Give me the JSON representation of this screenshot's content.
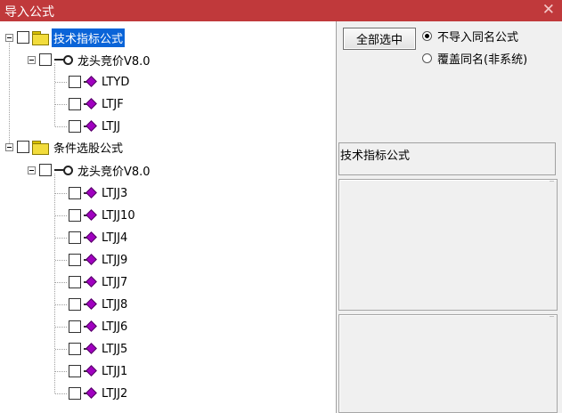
{
  "window": {
    "title": "导入公式",
    "close_glyph": "✕"
  },
  "tree": {
    "group1": {
      "label": "技术指标公式",
      "child": {
        "label": "龙头竞价V8.0",
        "items": [
          "LTYD",
          "LTJF",
          "LTJJ"
        ]
      }
    },
    "group2": {
      "label": "条件选股公式",
      "child": {
        "label": "龙头竞价V8.0",
        "items": [
          "LTJJ3",
          "LTJJ10",
          "LTJJ4",
          "LTJJ9",
          "LTJJ7",
          "LTJJ8",
          "LTJJ6",
          "LTJJ5",
          "LTJJ1",
          "LTJJ2"
        ]
      }
    }
  },
  "controls": {
    "select_all_label": "全部选中",
    "radio_no_import": "不导入同名公式",
    "radio_overwrite": "覆盖同名(非系统)",
    "selected_radio": "no_import"
  },
  "info": {
    "selected_type": "技术指标公式"
  },
  "colors": {
    "titlebar": "#c0393b",
    "selection": "#0a64d8",
    "formula_icon": "#a000c0",
    "folder": "#f2dc3c"
  }
}
